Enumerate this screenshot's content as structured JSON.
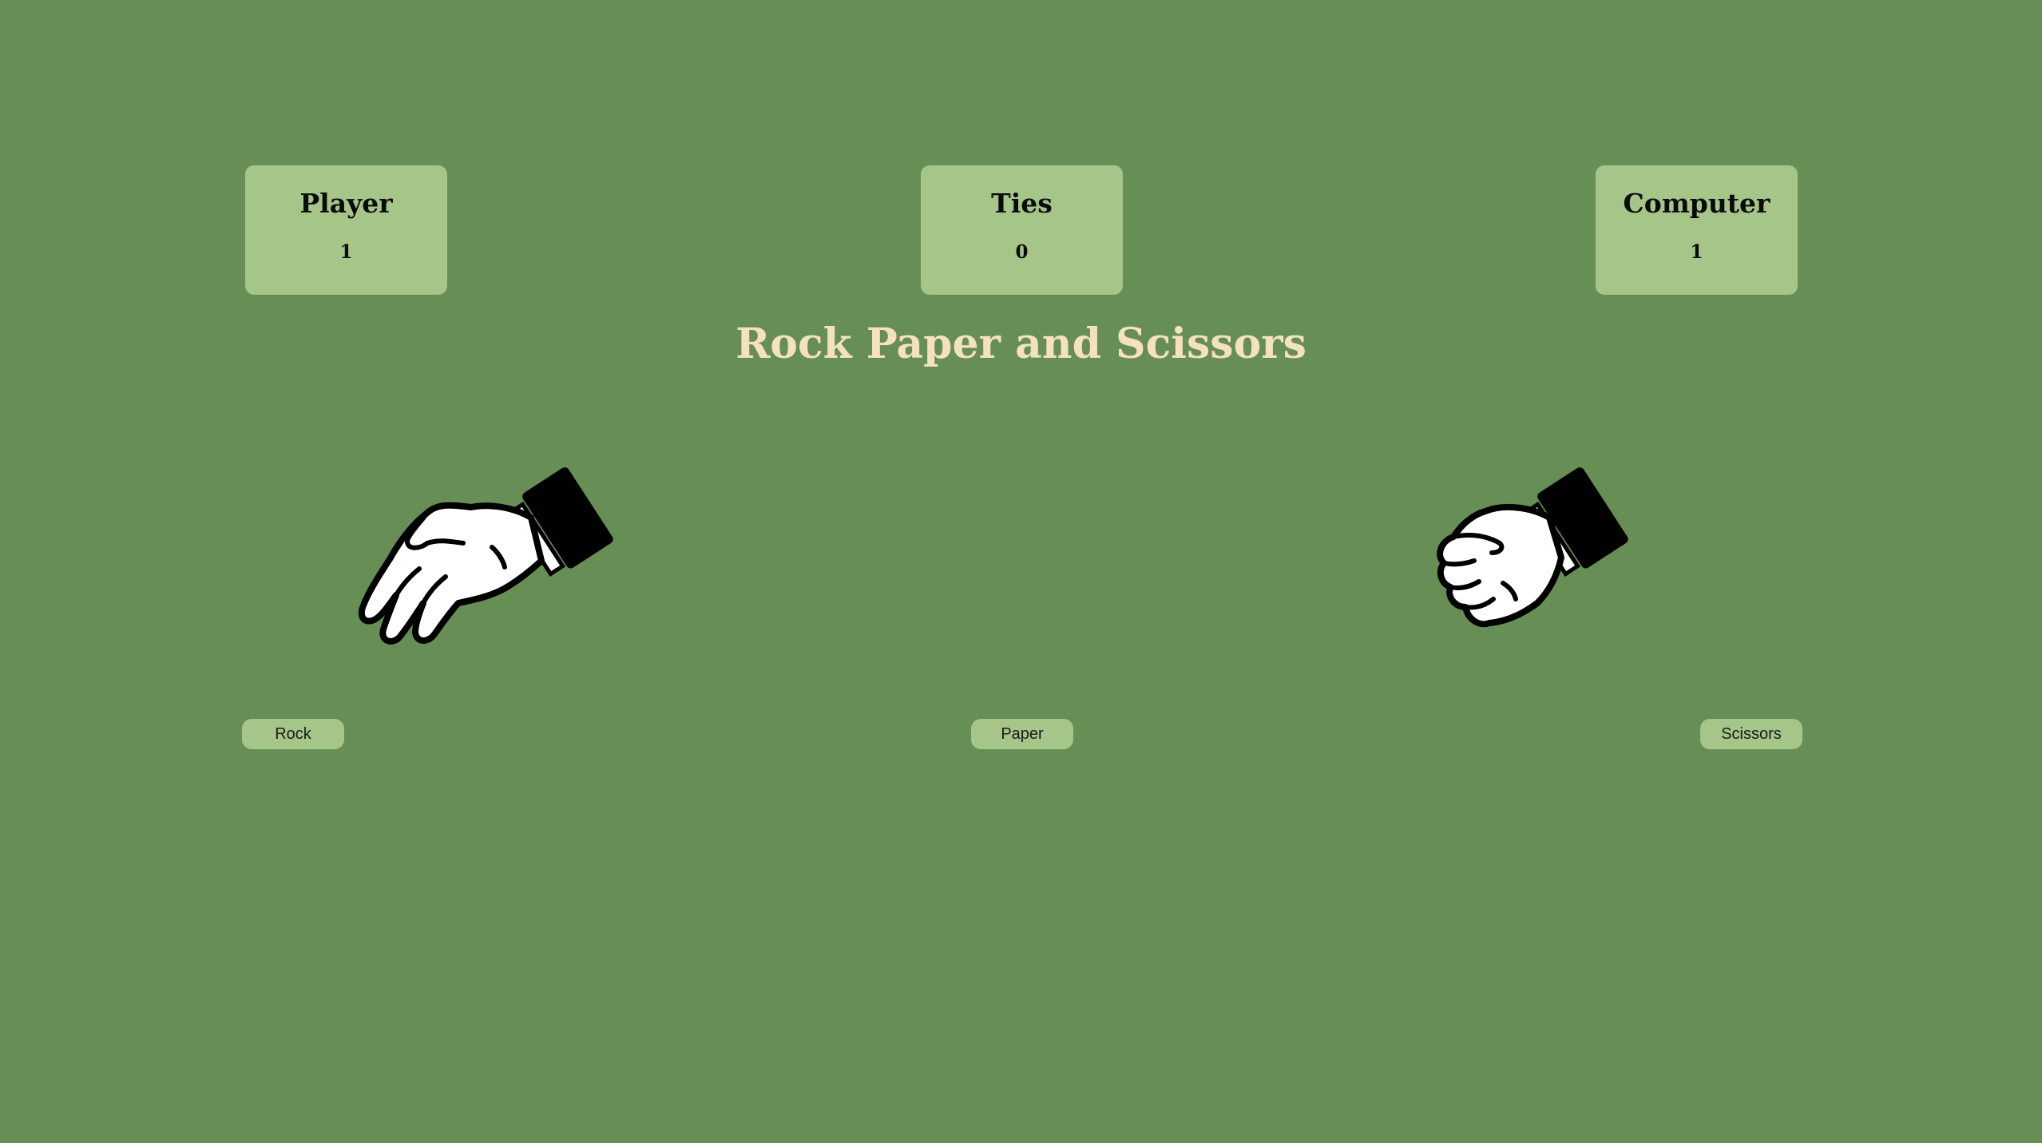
{
  "scoreboard": {
    "player": {
      "label": "Player",
      "score": "1"
    },
    "ties": {
      "label": "Ties",
      "score": "0"
    },
    "computer": {
      "label": "Computer",
      "score": "1"
    }
  },
  "title": "Rock Paper and Scissors",
  "hands": {
    "player": {
      "icon": "paper-hand-icon",
      "choice": "paper"
    },
    "computer": {
      "icon": "rock-fist-icon",
      "choice": "rock"
    }
  },
  "buttons": {
    "rock": "Rock",
    "paper": "Paper",
    "scissors": "Scissors"
  },
  "colors": {
    "background": "#668e55",
    "card": "#a5c589",
    "title": "#f5e2bd"
  }
}
